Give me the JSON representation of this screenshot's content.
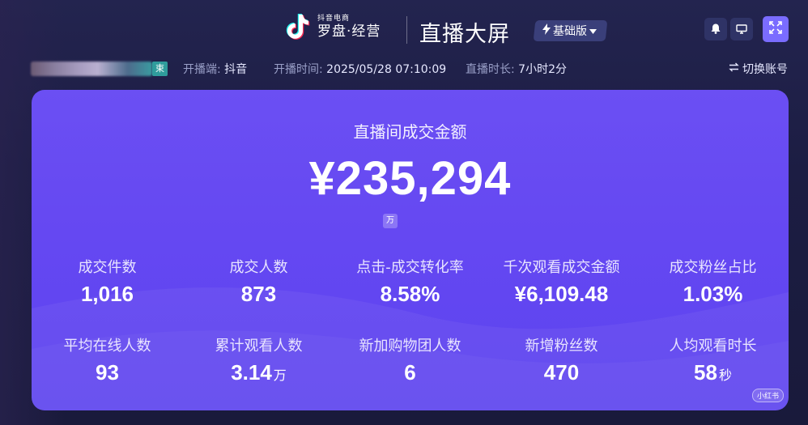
{
  "header": {
    "logo_small": "抖音电商",
    "logo_big": "罗盘·经营",
    "screen_title": "直播大屏",
    "edition": "基础版"
  },
  "info_bar": {
    "account_tag": "束",
    "platform_key": "开播端:",
    "platform_value": "抖音",
    "start_time_key": "开播时间:",
    "start_time_value": "2025/05/28 07:10:09",
    "duration_key": "直播时长:",
    "duration_value": "7小时2分",
    "switch_account": "切换账号"
  },
  "main": {
    "title": "直播间成交金额",
    "amount": "¥235,294",
    "unit": "万",
    "metrics_row1": [
      {
        "label": "成交件数",
        "value": "1,016",
        "unit": ""
      },
      {
        "label": "成交人数",
        "value": "873",
        "unit": ""
      },
      {
        "label": "点击-成交转化率",
        "value": "8.58%",
        "unit": ""
      },
      {
        "label": "千次观看成交金额",
        "value": "¥6,109.48",
        "unit": ""
      },
      {
        "label": "成交粉丝占比",
        "value": "1.03%",
        "unit": ""
      }
    ],
    "metrics_row2": [
      {
        "label": "平均在线人数",
        "value": "93",
        "unit": ""
      },
      {
        "label": "累计观看人数",
        "value": "3.14",
        "unit": "万"
      },
      {
        "label": "新加购物团人数",
        "value": "6",
        "unit": ""
      },
      {
        "label": "新增粉丝数",
        "value": "470",
        "unit": ""
      },
      {
        "label": "人均观看时长",
        "value": "58",
        "unit": "秒"
      }
    ]
  },
  "watermark": "小红书",
  "icons": {
    "logo": "douyin-note-icon",
    "edition": "lightning-icon",
    "dropdown": "caret-down-icon",
    "bell": "bell-icon",
    "monitor": "monitor-icon",
    "fullscreen": "fullscreen-icon",
    "switch": "switch-arrows-icon"
  },
  "colors": {
    "background": "#1c1d43",
    "card": "#6548f2",
    "accent_button": "#7a6cff",
    "account_tag": "#2f9c9c"
  }
}
